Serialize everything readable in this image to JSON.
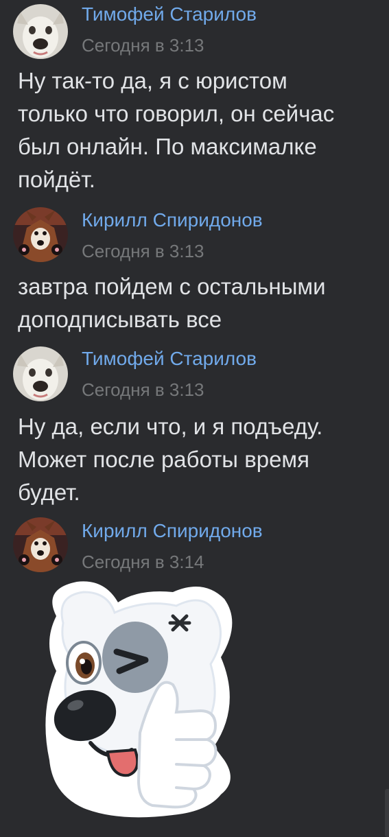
{
  "messages": [
    {
      "author": "Тимофей Старилов",
      "time": "Сегодня в 3:13",
      "lines": [
        "Ну так-то да, я с юристом",
        "только что говорил, он сейчас",
        "был онлайн. По максималке",
        "пойдёт."
      ]
    },
    {
      "author": "Кирилл Спиридонов",
      "time": "Сегодня в 3:13",
      "lines": [
        "завтра пойдем с остальными",
        "доподписывать все"
      ]
    },
    {
      "author": "Тимофей Старилов",
      "time": "Сегодня в 3:13",
      "lines": [
        "Ну да, если что, и я подъеду.",
        "Может после работы время",
        "будет."
      ]
    },
    {
      "author": "Кирилл Спиридонов",
      "time": "Сегодня в 3:14",
      "sticker": "winking-dog-thumbs-up-sticker"
    }
  ],
  "colors": {
    "background": "#2a2b2e",
    "author": "#71aaeb",
    "time": "#76787a",
    "text": "#e1e3e6"
  }
}
